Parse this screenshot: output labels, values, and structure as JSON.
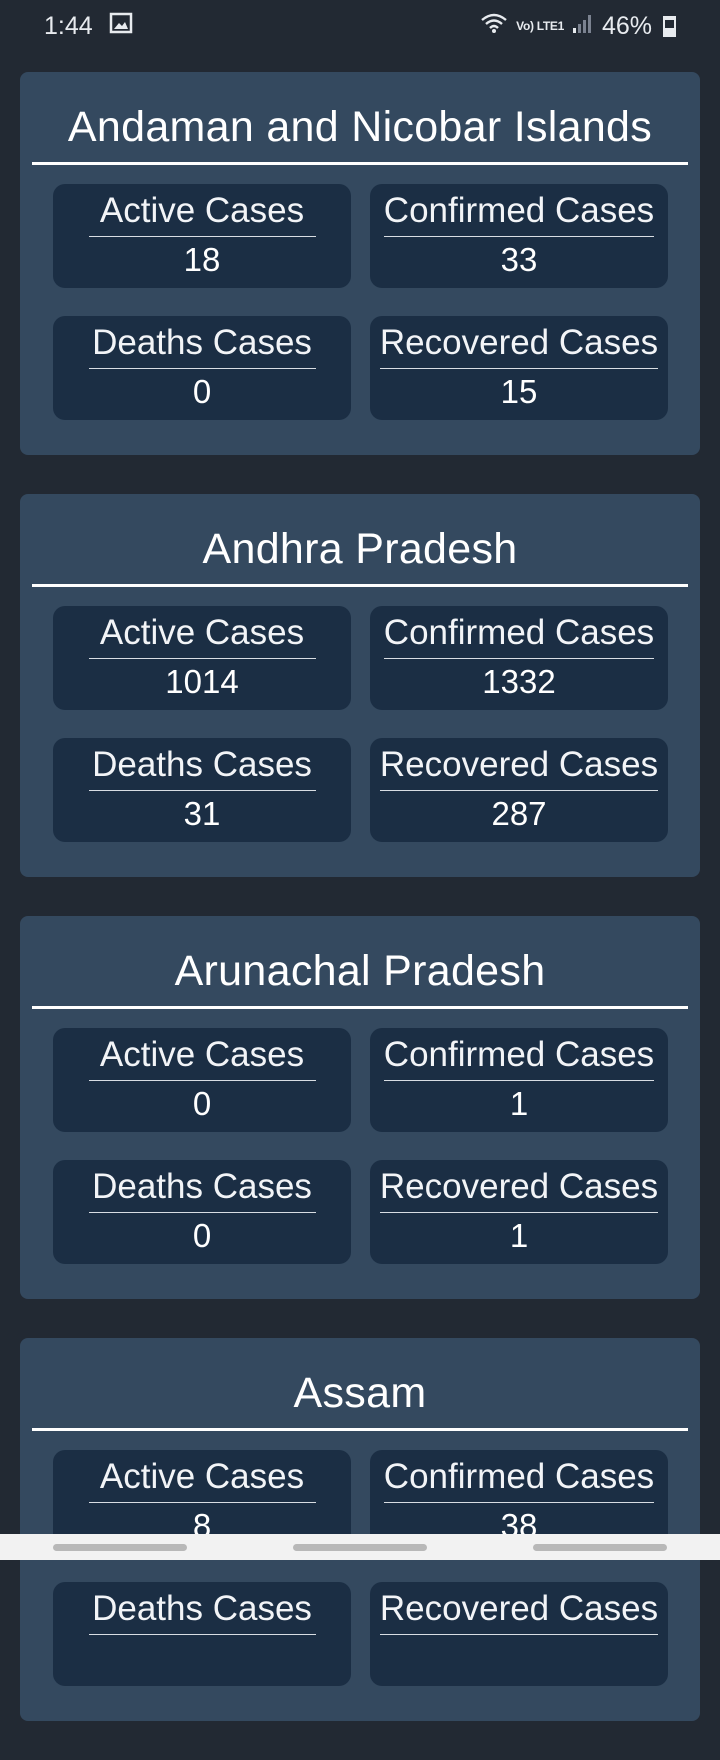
{
  "status_bar": {
    "time": "1:44",
    "network": "Vo) LTE1",
    "battery": "46%"
  },
  "states": [
    {
      "name": "Andaman and Nicobar Islands",
      "stats": [
        {
          "label": "Active Cases",
          "value": "18"
        },
        {
          "label": "Confirmed Cases",
          "value": "33"
        },
        {
          "label": "Deaths Cases",
          "value": "0"
        },
        {
          "label": "Recovered Cases",
          "value": "15"
        }
      ]
    },
    {
      "name": "Andhra Pradesh",
      "stats": [
        {
          "label": "Active Cases",
          "value": "1014"
        },
        {
          "label": "Confirmed Cases",
          "value": "1332"
        },
        {
          "label": "Deaths Cases",
          "value": "31"
        },
        {
          "label": "Recovered Cases",
          "value": "287"
        }
      ]
    },
    {
      "name": "Arunachal Pradesh",
      "stats": [
        {
          "label": "Active Cases",
          "value": "0"
        },
        {
          "label": "Confirmed Cases",
          "value": "1"
        },
        {
          "label": "Deaths Cases",
          "value": "0"
        },
        {
          "label": "Recovered Cases",
          "value": "1"
        }
      ]
    },
    {
      "name": "Assam",
      "stats": [
        {
          "label": "Active Cases",
          "value": "8"
        },
        {
          "label": "Confirmed Cases",
          "value": "38"
        },
        {
          "label": "Deaths Cases",
          "value": ""
        },
        {
          "label": "Recovered Cases",
          "value": ""
        }
      ]
    }
  ],
  "colors": {
    "background": "#222933",
    "card": "#34495f",
    "stat_box": "#1b2e44"
  }
}
